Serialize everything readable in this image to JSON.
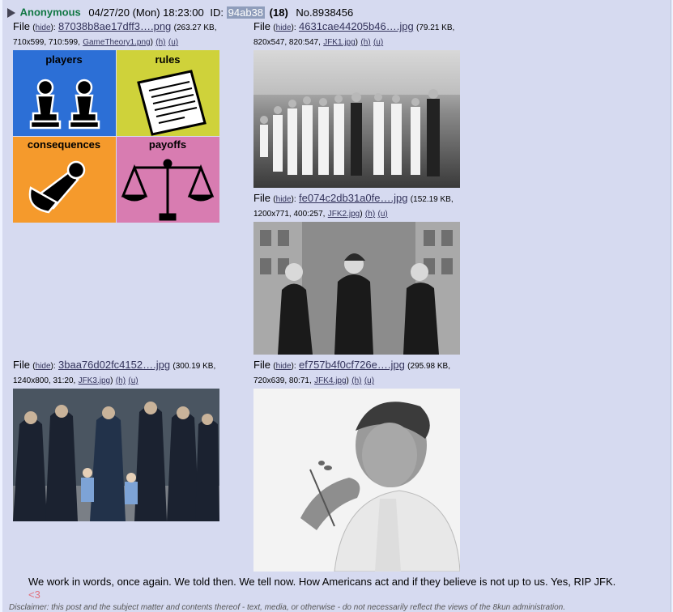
{
  "post": {
    "name": "Anonymous",
    "date": "04/27/20 (Mon) 18:23:00",
    "id_label": "ID:",
    "poster_id": "94ab38",
    "replies": "(18)",
    "post_no": "No.8938456",
    "files": [
      {
        "label": "File",
        "hide": "hide",
        "filename": "87038b8ae17dff3….png",
        "size": "263.27 KB",
        "dims": "710x599, 710:599,",
        "orig": "GameTheory1.png",
        "h": "(h)",
        "u": "(u)",
        "tiles": [
          "players",
          "rules",
          "consequences",
          "payoffs"
        ]
      },
      {
        "label": "File",
        "hide": "hide",
        "filename": "4631cae44205b46….jpg",
        "size": "79.21 KB",
        "dims": "820x547, 820:547,",
        "orig": "JFK1.jpg",
        "h": "(h)",
        "u": "(u)"
      },
      {
        "label": "File",
        "hide": "hide",
        "filename": "fe074c2db31a0fe….jpg",
        "size": "152.19 KB",
        "dims": "1200x771, 400:257,",
        "orig": "JFK2.jpg",
        "h": "(h)",
        "u": "(u)"
      },
      {
        "label": "File",
        "hide": "hide",
        "filename": "3baa76d02fc4152….jpg",
        "size": "300.19 KB",
        "dims": "1240x800, 31:20,",
        "orig": "JFK3.jpg",
        "h": "(h)",
        "u": "(u)"
      },
      {
        "label": "File",
        "hide": "hide",
        "filename": "ef757b4f0cf726e….jpg",
        "size": "295.98 KB",
        "dims": "720x639, 80:71,",
        "orig": "JFK4.jpg",
        "h": "(h)",
        "u": "(u)"
      }
    ],
    "body": "We work in words, once again. We told then. We tell now. How Americans act and if they believe is not up to us. Yes, RIP JFK.",
    "heart": "<3",
    "disclaimer": "Disclaimer: this post and the subject matter and contents thereof - text, media, or otherwise - do not necessarily reflect the views of the 8kun administration."
  },
  "colors": {
    "name": "#117743",
    "link": "#34345c",
    "post_bg": "#d6daf0",
    "poster_id_bg": "#8f9dbb",
    "tile_players": "#2c6fd6",
    "tile_rules": "#cfd23a",
    "tile_consequences": "#f59a2c",
    "tile_payoffs": "#d87cb1"
  }
}
